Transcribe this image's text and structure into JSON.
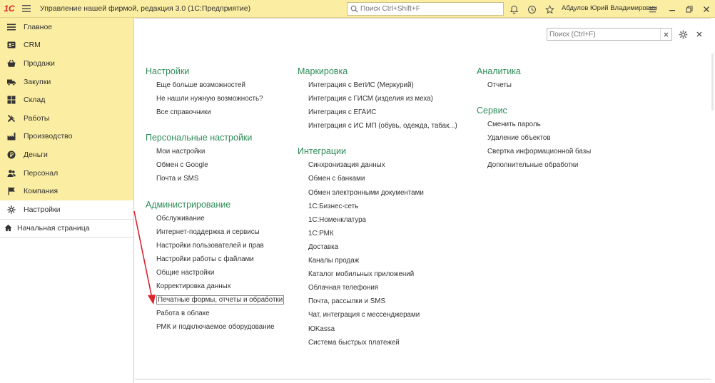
{
  "titlebar": {
    "logo": "1С",
    "title": "Управление нашей фирмой, редакция 3.0  (1С:Предприятие)",
    "search_placeholder": "Поиск Ctrl+Shift+F",
    "user": "Абдулов Юрий Владимирович"
  },
  "sidebar": {
    "items": [
      {
        "label": "Главное",
        "icon": "hamburger-icon"
      },
      {
        "label": "CRM",
        "icon": "crm-icon"
      },
      {
        "label": "Продажи",
        "icon": "basket-icon"
      },
      {
        "label": "Закупки",
        "icon": "truck-icon"
      },
      {
        "label": "Склад",
        "icon": "warehouse-icon"
      },
      {
        "label": "Работы",
        "icon": "tools-icon"
      },
      {
        "label": "Производство",
        "icon": "factory-icon"
      },
      {
        "label": "Деньги",
        "icon": "coin-icon"
      },
      {
        "label": "Персонал",
        "icon": "people-icon"
      },
      {
        "label": "Компания",
        "icon": "flag-icon"
      },
      {
        "label": "Настройки",
        "icon": "gear-icon"
      }
    ],
    "home": "Начальная страница"
  },
  "main": {
    "search_placeholder": "Поиск (Ctrl+F)",
    "col1": {
      "g1_title": "Настройки",
      "g1": [
        "Еще больше возможностей",
        "Не нашли нужную возможность?",
        "Все справочники"
      ],
      "g2_title": "Персональные настройки",
      "g2": [
        "Мои настройки",
        "Обмен с Google",
        "Почта и SMS"
      ],
      "g3_title": "Администрирование",
      "g3": [
        "Обслуживание",
        "Интернет-поддержка и сервисы",
        "Настройки пользователей и прав",
        "Настройки работы с файлами",
        "Общие настройки",
        "Корректировка данных",
        "Печатные формы, отчеты и обработки",
        "Работа в облаке",
        "РМК и подключаемое оборудование"
      ]
    },
    "col2": {
      "g1_title": "Маркировка",
      "g1": [
        "Интеграция с ВетИС (Меркурий)",
        "Интеграция с ГИСМ (изделия из меха)",
        "Интеграция с ЕГАИС",
        "Интеграция с ИС МП (обувь, одежда, табак...)"
      ],
      "g2_title": "Интеграции",
      "g2": [
        "Синхронизация данных",
        "Обмен с банками",
        "Обмен электронными документами",
        "1С:Бизнес-сеть",
        "1С:Номенклатура",
        "1С:РМК",
        "Доставка",
        "Каналы продаж",
        "Каталог мобильных приложений",
        "Облачная телефония",
        "Почта, рассылки и SMS",
        "Чат, интеграция с мессенджерами",
        "ЮKassa",
        "Система быстрых платежей"
      ]
    },
    "col3": {
      "g1_title": "Аналитика",
      "g1": [
        "Отчеты"
      ],
      "g2_title": "Сервис",
      "g2": [
        "Сменить пароль",
        "Удаление объектов",
        "Свертка информационной базы",
        "Дополнительные обработки"
      ]
    }
  },
  "colors": {
    "accent_yellow": "#fbeda1",
    "group_green": "#2e8b57",
    "arrow_red": "#d9262c"
  }
}
